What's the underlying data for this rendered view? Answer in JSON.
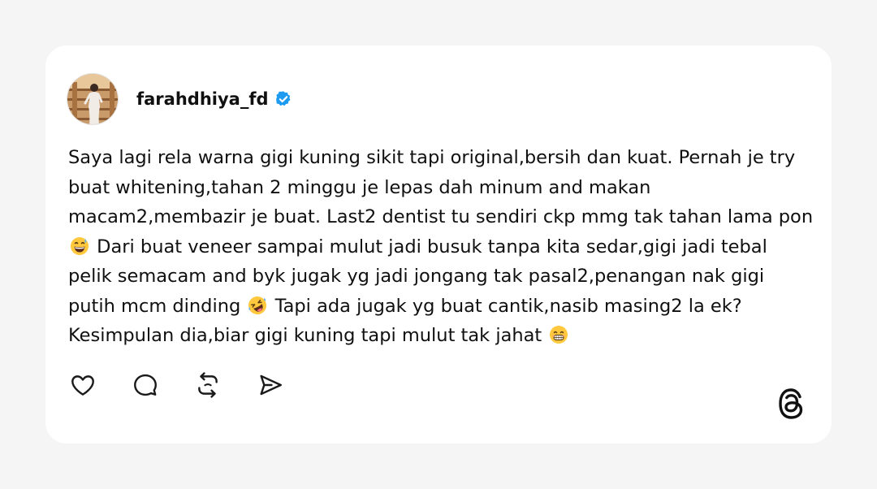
{
  "post": {
    "username": "farahdhiya_fd",
    "verified": true,
    "text_parts": [
      "Saya lagi rela warna gigi kuning sikit tapi original,bersih dan kuat. Pernah je try buat whitening,tahan 2 minggu je lepas dah minum and makan macam2,membazir je buat. Last2 dentist tu sendiri ckp mmg tak tahan lama pon",
      "Dari buat veneer sampai mulut jadi busuk tanpa kita sedar,gigi jadi tebal pelik semacam and byk jugak yg jadi jongang tak pasal2,penangan nak gigi putih mcm dinding",
      "Tapi ada jugak yg buat cantik,nasib masing2 la ek? Kesimpulan dia,biar gigi kuning tapi mulut tak jahat"
    ],
    "emojis": [
      "grinning-sweat-emoji",
      "rolling-on-floor-laughing-emoji",
      "beaming-grin-emoji"
    ]
  },
  "actions": [
    {
      "name": "like",
      "icon": "heart-icon"
    },
    {
      "name": "comment",
      "icon": "speech-bubble-icon"
    },
    {
      "name": "repost",
      "icon": "repost-icon"
    },
    {
      "name": "share",
      "icon": "send-icon"
    }
  ],
  "brand": {
    "logo": "threads-logo-icon"
  },
  "colors": {
    "background": "#f5f5f5",
    "card": "#ffffff",
    "text": "#101010",
    "verified_badge": "#1d9bf0",
    "icon_stroke": "#1a1a1a"
  }
}
